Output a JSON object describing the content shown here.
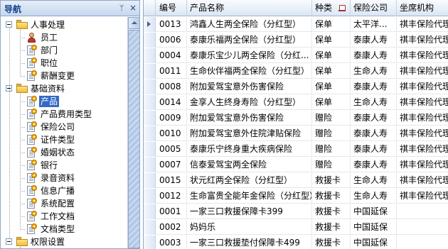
{
  "nav": {
    "title": "导航",
    "pin_glyph": "ᛘ",
    "close_glyph": "×",
    "tree": [
      {
        "label": "人事处理",
        "icon": "folder-icon",
        "level": 0,
        "expanded": true
      },
      {
        "label": "员工",
        "icon": "person-icon",
        "level": 1
      },
      {
        "label": "部门",
        "icon": "doc-gear-icon",
        "level": 1
      },
      {
        "label": "职位",
        "icon": "doc-gear-icon",
        "level": 1
      },
      {
        "label": "薪酬变更",
        "icon": "doc-gear-icon",
        "level": 1
      },
      {
        "label": "基础资料",
        "icon": "folder-icon",
        "level": 0,
        "expanded": true
      },
      {
        "label": "产品",
        "icon": "doc-gear-icon",
        "level": 1,
        "selected": true
      },
      {
        "label": "产品费用类型",
        "icon": "doc-gear-icon",
        "level": 1
      },
      {
        "label": "保险公司",
        "icon": "doc-gear-icon",
        "level": 1
      },
      {
        "label": "证件类型",
        "icon": "doc-gear-icon",
        "level": 1
      },
      {
        "label": "婚姻状态",
        "icon": "doc-gear-icon",
        "level": 1
      },
      {
        "label": "银行",
        "icon": "doc-gear-icon",
        "level": 1
      },
      {
        "label": "录音资料",
        "icon": "doc-gear-icon",
        "level": 1
      },
      {
        "label": "信息广播",
        "icon": "doc-gear-icon",
        "level": 1
      },
      {
        "label": "系统配置",
        "icon": "doc-gear-icon",
        "level": 1
      },
      {
        "label": "工作文档",
        "icon": "doc-gear-icon",
        "level": 1
      },
      {
        "label": "文档类型",
        "icon": "doc-gear-icon",
        "level": 1
      },
      {
        "label": "权限设置",
        "icon": "folder-icon",
        "level": 0,
        "expanded": true
      }
    ]
  },
  "grid": {
    "columns": [
      "编号",
      "产品名称",
      "种类",
      "保险公司",
      "坐席机构"
    ],
    "sort_icon": "sort-icon",
    "rows": [
      [
        "0013",
        "鸿鑫人生两全保险（分红型）",
        "保单",
        "太平洋...",
        "祺丰保险代理"
      ],
      [
        "0006",
        "泰康乐福两全保险（分红型）",
        "保单",
        "泰康人寿",
        "祺丰保险代理"
      ],
      [
        "0004",
        "泰康乐宝少儿两全保险（分红...",
        "保单",
        "泰康人寿",
        "祺丰保险代理"
      ],
      [
        "0011",
        "生命伙伴福两全保险（分红型）",
        "保单",
        "生命人寿",
        "祺丰保险代理"
      ],
      [
        "0008",
        "附加爱驾宝意外伤害保险",
        "保单",
        "泰康人寿",
        "祺丰保险代理"
      ],
      [
        "0014",
        "金享人生终身寿险（分红型）",
        "保单",
        "生命人寿",
        "祺丰保险代理"
      ],
      [
        "0009",
        "附加爱驾宝意外伤害保险",
        "赠险",
        "泰康人寿",
        "祺丰保险代理"
      ],
      [
        "0010",
        "附加爱驾宝意外住院津贴保险",
        "赠险",
        "泰康人寿",
        "祺丰保险代理"
      ],
      [
        "0005",
        "泰康乐宁终身重大疾病保险",
        "赠险",
        "泰康人寿",
        "祺丰保险代理"
      ],
      [
        "0007",
        "信泰爱驾宝两全保险",
        "赠险",
        "泰康人寿",
        "祺丰保险代理"
      ],
      [
        "0015",
        "状元红两全保险（分红型）",
        "救援卡",
        "生命人寿",
        "祺丰保险代理"
      ],
      [
        "0012",
        "生命富贵全能年金保险（分红型）",
        "救援卡",
        "生命人寿",
        "祺丰保险代理"
      ],
      [
        "0001",
        "一家三口救援保障卡399",
        "救援卡",
        "中国延保",
        ""
      ],
      [
        "0002",
        "妈妈乐",
        "救援卡",
        "中国延保",
        ""
      ],
      [
        "0003",
        "一家三口救援垫付保障卡499",
        "救援卡",
        "中国延保",
        ""
      ]
    ]
  }
}
